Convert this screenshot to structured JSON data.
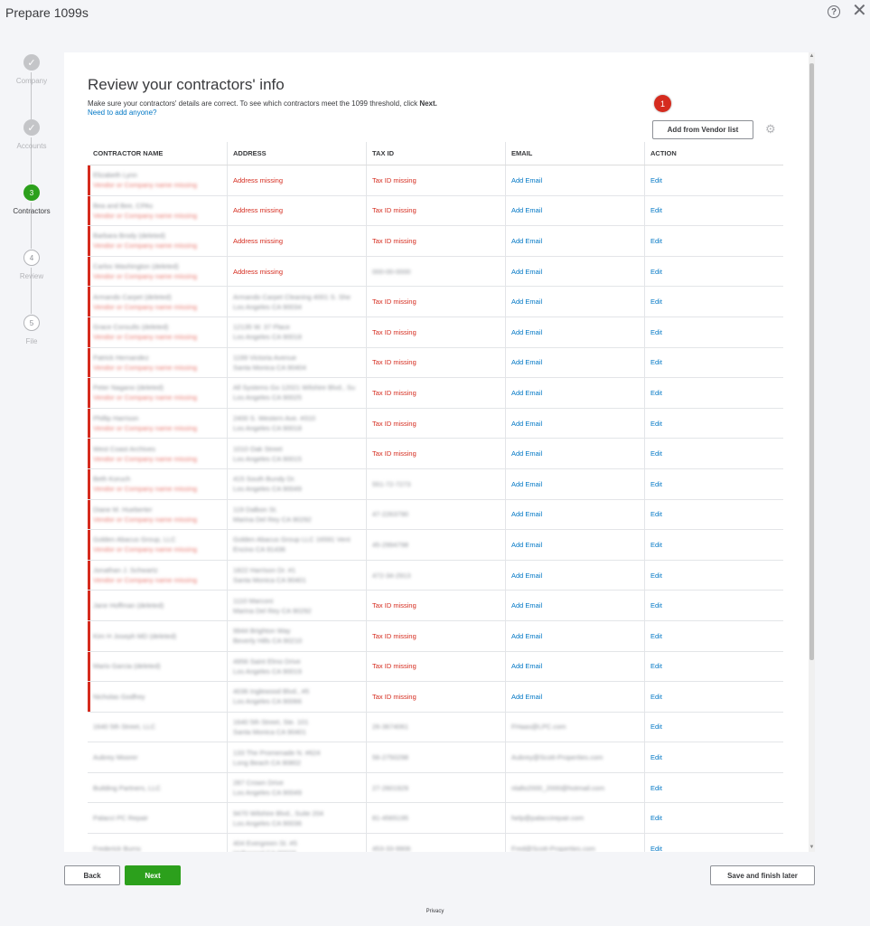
{
  "app": {
    "title": "Prepare 1099s"
  },
  "stepper": [
    {
      "label": "Company",
      "mark": "✓",
      "state": "done"
    },
    {
      "label": "Accounts",
      "mark": "✓",
      "state": "done"
    },
    {
      "label": "Contractors",
      "mark": "3",
      "state": "active"
    },
    {
      "label": "Review",
      "mark": "4",
      "state": "todo"
    },
    {
      "label": "File",
      "mark": "5",
      "state": "todo"
    }
  ],
  "main": {
    "title": "Review your contractors' info",
    "description": "Make sure your contractors' details are correct. To see which contractors meet the 1099 threshold, click ",
    "description_bold": "Next.",
    "add_anyone_link": "Need to add anyone?",
    "badge_count": "1",
    "add_vendor_button": "Add from Vendor list"
  },
  "table": {
    "headers": [
      "CONTRACTOR NAME",
      "ADDRESS",
      "TAX ID",
      "EMAIL",
      "ACTION"
    ],
    "rows": [
      {
        "name": "Elizabeth Lynn",
        "sub": "Vendor or Company name missing",
        "address": "Address missing",
        "addr_err": true,
        "addr2": "",
        "taxid": "Tax ID missing",
        "tax_err": true,
        "email": "Add Email",
        "email_link": true,
        "action": "Edit",
        "flag": true
      },
      {
        "name": "Bea and Bee, CPAs",
        "sub": "Vendor or Company name missing",
        "address": "Address missing",
        "addr_err": true,
        "addr2": "",
        "taxid": "Tax ID missing",
        "tax_err": true,
        "email": "Add Email",
        "email_link": true,
        "action": "Edit",
        "flag": true
      },
      {
        "name": "Barbara Brody (deleted)",
        "sub": "Vendor or Company name missing",
        "address": "Address missing",
        "addr_err": true,
        "addr2": "",
        "taxid": "Tax ID missing",
        "tax_err": true,
        "email": "Add Email",
        "email_link": true,
        "action": "Edit",
        "flag": true
      },
      {
        "name": "Carlos Washington (deleted)",
        "sub": "Vendor or Company name missing",
        "address": "Address missing",
        "addr_err": true,
        "addr2": "",
        "taxid": "000-00-0000",
        "tax_err": false,
        "email": "Add Email",
        "email_link": true,
        "action": "Edit",
        "flag": true
      },
      {
        "name": "Armando Carpet (deleted)",
        "sub": "Vendor or Company name missing",
        "address": "Armando Carpet Cleaning 4001 S. She",
        "addr_err": false,
        "addr2": "Los Angeles CA 90034",
        "taxid": "Tax ID missing",
        "tax_err": true,
        "email": "Add Email",
        "email_link": true,
        "action": "Edit",
        "flag": true
      },
      {
        "name": "Grace Consults (deleted)",
        "sub": "Vendor or Company name missing",
        "address": "12135 W. 37 Place",
        "addr_err": false,
        "addr2": "Los Angeles CA 90018",
        "taxid": "Tax ID missing",
        "tax_err": true,
        "email": "Add Email",
        "email_link": true,
        "action": "Edit",
        "flag": true
      },
      {
        "name": "Patrick Hernandez",
        "sub": "Vendor or Company name missing",
        "address": "1199 Victoria Avenue",
        "addr_err": false,
        "addr2": "Santa Monica CA 90404",
        "taxid": "Tax ID missing",
        "tax_err": true,
        "email": "Add Email",
        "email_link": true,
        "action": "Edit",
        "flag": true
      },
      {
        "name": "Peter Nagano (deleted)",
        "sub": "Vendor or Company name missing",
        "address": "All Systems Go 12021 Wilshire Blvd., Su",
        "addr_err": false,
        "addr2": "Los Angeles CA 90025",
        "taxid": "Tax ID missing",
        "tax_err": true,
        "email": "Add Email",
        "email_link": true,
        "action": "Edit",
        "flag": true
      },
      {
        "name": "Phillip Harrison",
        "sub": "Vendor or Company name missing",
        "address": "2400 S. Western Ave. #310",
        "addr_err": false,
        "addr2": "Los Angeles CA 90018",
        "taxid": "Tax ID missing",
        "tax_err": true,
        "email": "Add Email",
        "email_link": true,
        "action": "Edit",
        "flag": true
      },
      {
        "name": "West Coast Archives",
        "sub": "Vendor or Company name missing",
        "address": "1010 Oak Street",
        "addr_err": false,
        "addr2": "Los Angeles CA 90015",
        "taxid": "Tax ID missing",
        "tax_err": true,
        "email": "Add Email",
        "email_link": true,
        "action": "Edit",
        "flag": true
      },
      {
        "name": "Beth Koruch",
        "sub": "Vendor or Company name missing",
        "address": "415 South Bundy Dr.",
        "addr_err": false,
        "addr2": "Los Angeles CA 90049",
        "taxid": "551-72-7273",
        "tax_err": false,
        "email": "Add Email",
        "email_link": true,
        "action": "Edit",
        "flag": true
      },
      {
        "name": "Diane M. Hueberter",
        "sub": "Vendor or Company name missing",
        "address": "119 Dalbon St.",
        "addr_err": false,
        "addr2": "Marina Del Rey CA 90292",
        "taxid": "47-2263790",
        "tax_err": false,
        "email": "Add Email",
        "email_link": true,
        "action": "Edit",
        "flag": true
      },
      {
        "name": "Golden Abacus Group, LLC",
        "sub": "Vendor or Company name missing",
        "address": "Golden Abacus Group LLC 16591 Vent",
        "addr_err": false,
        "addr2": "Encino CA 91436",
        "taxid": "45-2994798",
        "tax_err": false,
        "email": "Add Email",
        "email_link": true,
        "action": "Edit",
        "flag": true
      },
      {
        "name": "Jonathan J. Schwartz",
        "sub": "Vendor or Company name missing",
        "address": "1822 Harrison Dr. #1",
        "addr_err": false,
        "addr2": "Santa Monica CA 90401",
        "taxid": "472-34-2913",
        "tax_err": false,
        "email": "Add Email",
        "email_link": true,
        "action": "Edit",
        "flag": true
      },
      {
        "name": "Jane Hoffman (deleted)",
        "sub": "",
        "address": "1110 Marconi",
        "addr_err": false,
        "addr2": "Marina Del Rey CA 90292",
        "taxid": "Tax ID missing",
        "tax_err": true,
        "email": "Add Email",
        "email_link": true,
        "action": "Edit",
        "flag": true
      },
      {
        "name": "Kim H Joseph MD (deleted)",
        "sub": "",
        "address": "9944 Brighton Way",
        "addr_err": false,
        "addr2": "Beverly Hills CA 90210",
        "taxid": "Tax ID missing",
        "tax_err": true,
        "email": "Add Email",
        "email_link": true,
        "action": "Edit",
        "flag": true
      },
      {
        "name": "Mario Garcia (deleted)",
        "sub": "",
        "address": "4956 Saint Elmo Drive",
        "addr_err": false,
        "addr2": "Los Angeles CA 90019",
        "taxid": "Tax ID missing",
        "tax_err": true,
        "email": "Add Email",
        "email_link": true,
        "action": "Edit",
        "flag": true
      },
      {
        "name": "Nicholas Godfrey",
        "sub": "",
        "address": "4036 Inglewood Blvd., #5",
        "addr_err": false,
        "addr2": "Los Angeles CA 90066",
        "taxid": "Tax ID missing",
        "tax_err": true,
        "email": "Add Email",
        "email_link": true,
        "action": "Edit",
        "flag": true
      },
      {
        "name": "1640 5th Street, LLC",
        "sub": "",
        "address": "1640 5th Street, Ste. 101",
        "addr_err": false,
        "addr2": "Santa Monica CA 90401",
        "taxid": "26-3674061",
        "tax_err": false,
        "email": "FHaas@LPC.com",
        "email_link": false,
        "action": "Edit",
        "flag": false
      },
      {
        "name": "Aubrey Moorer",
        "sub": "",
        "address": "133 The Promenade N. #624",
        "addr_err": false,
        "addr2": "Long Beach CA 90802",
        "taxid": "56-2750298",
        "tax_err": false,
        "email": "Aubrey@Scott-Properties.com",
        "email_link": false,
        "action": "Edit",
        "flag": false
      },
      {
        "name": "Building Partners, LLC",
        "sub": "",
        "address": "287 Crown Drive",
        "addr_err": false,
        "addr2": "Los Angeles CA 90049",
        "taxid": "27-2601929",
        "tax_err": false,
        "email": "nlallo2000_2000@hotmail.com",
        "email_link": false,
        "action": "Edit",
        "flag": false
      },
      {
        "name": "Palacci PC Repair",
        "sub": "",
        "address": "9470 Wilshire Blvd., Suite 204",
        "addr_err": false,
        "addr2": "Los Angeles CA 90036",
        "taxid": "81-4565195",
        "tax_err": false,
        "email": "help@palaccirepair.com",
        "email_link": false,
        "action": "Edit",
        "flag": false
      },
      {
        "name": "Frederick Burns",
        "sub": "",
        "address": "404 Evergreen St. #5",
        "addr_err": false,
        "addr2": "Hollywood CA 90028",
        "taxid": "453-33-9906",
        "tax_err": false,
        "email": "Fred@Scott-Properties.com",
        "email_link": false,
        "action": "Edit",
        "flag": false
      }
    ]
  },
  "footer": {
    "back_button": "Back",
    "next_button": "Next",
    "save_button": "Save and finish later",
    "privacy_link": "Privacy"
  },
  "colors": {
    "accent": "#2ca01c",
    "error": "#d52b1e",
    "link": "#0077c5"
  }
}
